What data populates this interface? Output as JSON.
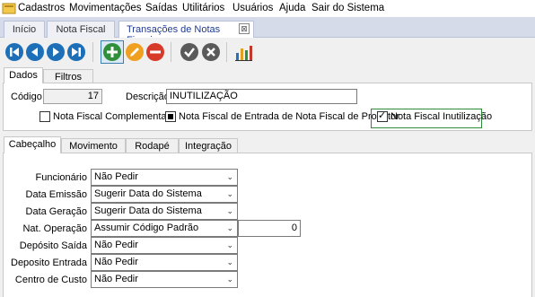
{
  "menu": {
    "items": [
      "Cadastros",
      "Movimentações",
      "Saídas",
      "Utilitários",
      "Usuários",
      "Ajuda",
      "Sair do Sistema"
    ]
  },
  "tabs": {
    "inicio": "Início",
    "nota_fiscal": "Nota Fiscal",
    "transacoes": "Transações de Notas Fiscais",
    "close_glyph": "⊠"
  },
  "toolbar": {
    "icons": [
      "first-icon",
      "previous-icon",
      "next-icon",
      "last-icon",
      "add-icon",
      "edit-icon",
      "delete-icon",
      "confirm-icon",
      "cancel-icon",
      "report-icon"
    ]
  },
  "main_tabs": {
    "dados": "Dados",
    "filtros": "Filtros"
  },
  "dados": {
    "codigo_label": "Código",
    "codigo_value": "17",
    "descricao_label": "Descrição",
    "descricao_value": "INUTILIZAÇÃO",
    "nf_complementar_label": "Nota Fiscal Complementar",
    "nf_entrada_label": "Nota Fiscal de Entrada de Nota Fiscal de Produtor",
    "nf_inutilizacao_label": "Nota Fiscal Inutilização",
    "check_glyph": "✓"
  },
  "section_tabs": {
    "cabecalho": "Cabeçalho",
    "movimento": "Movimento",
    "rodape": "Rodapé",
    "integracao": "Integração"
  },
  "cabecalho": {
    "funcionario_label": "Funcionário",
    "funcionario_value": "Não Pedir",
    "data_emissao_label": "Data Emissão",
    "data_emissao_value": "Sugerir Data do Sistema",
    "data_geracao_label": "Data Geração",
    "data_geracao_value": "Sugerir Data do Sistema",
    "nat_operacao_label": "Nat. Operação",
    "nat_operacao_value": "Assumir Código Padrão",
    "nat_operacao_code": "0",
    "deposito_saida_label": "Depósito Saída",
    "deposito_saida_value": "Não Pedir",
    "deposito_entrada_label": "Deposito Entrada",
    "deposito_entrada_value": "Não Pedir",
    "centro_custo_label": "Centro de Custo",
    "centro_custo_value": "Não Pedir",
    "chevron_glyph": "⌄"
  },
  "colors": {
    "nav_blue": "#1d6fb8",
    "add_green": "#2f8f3a",
    "edit_orange": "#f0a020",
    "delete_red": "#d83a2a",
    "grey_action": "#5a5a5a",
    "highlight_green": "#2e8b3a"
  }
}
